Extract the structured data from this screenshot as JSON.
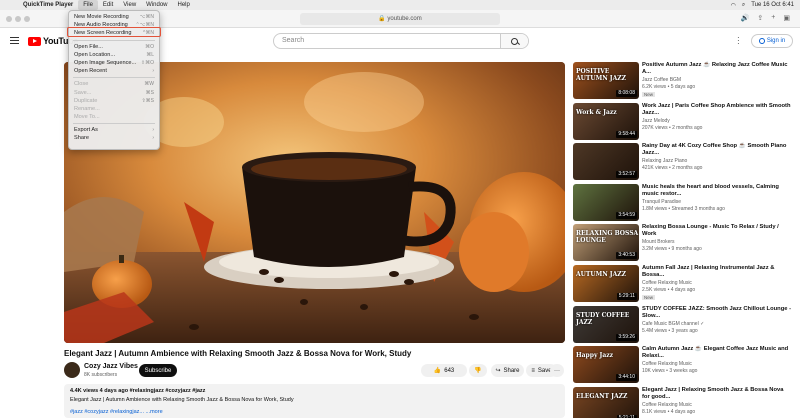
{
  "menubar": {
    "app": "QuickTime Player",
    "items": [
      "File",
      "Edit",
      "View",
      "Window",
      "Help"
    ],
    "datetime": "Tue 16 Oct  6:41"
  },
  "browser": {
    "url": "youtube.com"
  },
  "file_menu": {
    "items": [
      {
        "label": "New Movie Recording",
        "shortcut": "⌥⌘N",
        "enabled": true
      },
      {
        "label": "New Audio Recording",
        "shortcut": "⌃⌥⌘N",
        "enabled": true
      },
      {
        "label": "New Screen Recording",
        "shortcut": "^⌘N",
        "enabled": true,
        "highlighted": true
      },
      {
        "label": "Open File...",
        "shortcut": "⌘O",
        "enabled": true
      },
      {
        "label": "Open Location...",
        "shortcut": "⌘L",
        "enabled": true
      },
      {
        "label": "Open Image Sequence...",
        "shortcut": "⇧⌘O",
        "enabled": true
      },
      {
        "label": "Open Recent",
        "shortcut": "›",
        "enabled": true
      },
      {
        "label": "Close",
        "shortcut": "⌘W",
        "enabled": false
      },
      {
        "label": "Save...",
        "shortcut": "⌘S",
        "enabled": false
      },
      {
        "label": "Duplicate",
        "shortcut": "⇧⌘S",
        "enabled": false
      },
      {
        "label": "Rename...",
        "shortcut": "",
        "enabled": false
      },
      {
        "label": "Move To...",
        "shortcut": "",
        "enabled": false
      },
      {
        "label": "Export As",
        "shortcut": "›",
        "enabled": true
      },
      {
        "label": "Share",
        "shortcut": "›",
        "enabled": true
      }
    ]
  },
  "youtube": {
    "logo": "YouTube",
    "search_placeholder": "Search",
    "signin": "Sign in"
  },
  "video": {
    "title": "Elegant Jazz | Autumn Ambience with Relaxing Smooth Jazz & Bossa Nova for Work, Study",
    "channel": "Cozy Jazz Vibes",
    "subscribers": "8K subscribers",
    "subscribe": "Subscribe",
    "likes": "643",
    "share": "Share",
    "save": "Save",
    "more": "···",
    "meta": "4.4K views  4 days ago  #relaxingjazz #cozyjazz #jazz",
    "description": "Elegant Jazz | Autumn Ambience with Relaxing Smooth Jazz & Bossa Nova for Work, Study",
    "tags": "#jazz #cozyjazz #relaxingjaz...  ...more"
  },
  "recommendations": [
    {
      "title": "Positive Autumn Jazz ☕ Relaxing Jazz Coffee Music A...",
      "channel": "Jazz Coffee BGM",
      "stats": "6.2K views • 5 days ago",
      "duration": "8:08:08",
      "overlay": "POSITIVE AUTUMN JAZZ",
      "badge": "New",
      "color": "#a0521e"
    },
    {
      "title": "Work Jazz | Paris Coffee Shop Ambience with Smooth Jazz...",
      "channel": "Jazz Melody",
      "stats": "207K views • 2 months ago",
      "duration": "9:58:44",
      "overlay": "Work & Jazz",
      "badge": "",
      "color": "#6b4a33"
    },
    {
      "title": "Rainy Day at 4K Cozy Coffee Shop ☕ Smooth Piano Jazz...",
      "channel": "Relaxing Jazz Piano",
      "stats": "421K views • 2 months ago",
      "duration": "3:52:57",
      "overlay": "",
      "badge": "",
      "color": "#4e3826"
    },
    {
      "title": "Music heals the heart and blood vessels, Calming music restor...",
      "channel": "Tranquil Paradise",
      "stats": "1.8M views • Streamed 3 months ago",
      "duration": "3:54:59",
      "overlay": "",
      "badge": "",
      "color": "#5f7340"
    },
    {
      "title": "Relaxing Bossa Lounge - Music To Relax / Study / Work",
      "channel": "Mount Brokers",
      "stats": "3.2M views • 9 months ago",
      "duration": "3:40:53",
      "overlay": "RELAXING BOSSA LOUNGE",
      "badge": "",
      "color": "#c2a078"
    },
    {
      "title": "Autumn Fall Jazz | Relaxing Instrumental Jazz & Bossa...",
      "channel": "Coffee Relaxing Music",
      "stats": "2.5K views • 4 days ago",
      "duration": "5:29:11",
      "overlay": "AUTUMN JAZZ",
      "badge": "New",
      "color": "#b86a23"
    },
    {
      "title": "STUDY COFFEE JAZZ: Smooth Jazz Chillout Lounge - Slow...",
      "channel": "Cafe Music BGM channel ✓",
      "stats": "5.4M views • 3 years ago",
      "duration": "3:59:26",
      "overlay": "STUDY COFFEE JAZZ",
      "badge": "",
      "color": "#3f3b38"
    },
    {
      "title": "Calm Autumn Jazz ☕ Elegant Coffee Jazz Music and Relaxi...",
      "channel": "Coffee Relaxing Music",
      "stats": "10K views • 3 weeks ago",
      "duration": "3:44:10",
      "overlay": "Happy Jazz",
      "badge": "",
      "color": "#8e4a1e"
    },
    {
      "title": "Elegant Jazz | Relaxing Smooth Jazz & Bossa Nova for good...",
      "channel": "Coffee Relaxing Music",
      "stats": "8.1K views • 4 days ago",
      "duration": "5:21:11",
      "overlay": "ELEGANT JAZZ",
      "badge": "",
      "color": "#7a4622"
    }
  ]
}
